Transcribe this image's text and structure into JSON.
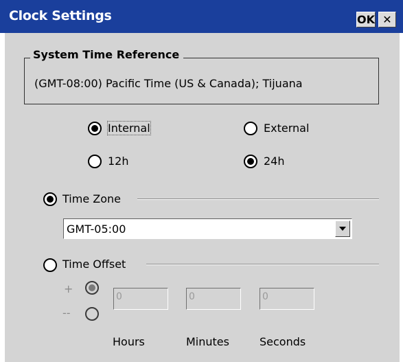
{
  "window": {
    "title": "Clock Settings",
    "ok_label": "OK",
    "close_label": "✕"
  },
  "system_time": {
    "title": "System Time Reference",
    "zone_text": "(GMT-08:00) Pacific Time (US & Canada); Tijuana"
  },
  "source": {
    "internal_label": "Internal",
    "external_label": "External",
    "selected": "Internal"
  },
  "format": {
    "h12_label": "12h",
    "h24_label": "24h",
    "selected": "24h"
  },
  "mode": {
    "time_zone_label": "Time Zone",
    "time_offset_label": "Time Offset",
    "selected": "Time Zone"
  },
  "time_zone": {
    "value": "GMT-05:00"
  },
  "offset": {
    "plus_sign": "+",
    "minus_sign": "--",
    "hours": "0",
    "minutes": "0",
    "seconds": "0",
    "hours_label": "Hours",
    "minutes_label": "Minutes",
    "seconds_label": "Seconds"
  },
  "icons": {
    "dropdown": "chevron-down-icon",
    "close": "close-icon"
  },
  "colors": {
    "titlebar": "#1a3f9c",
    "dialog_bg": "#d4d4d4"
  }
}
